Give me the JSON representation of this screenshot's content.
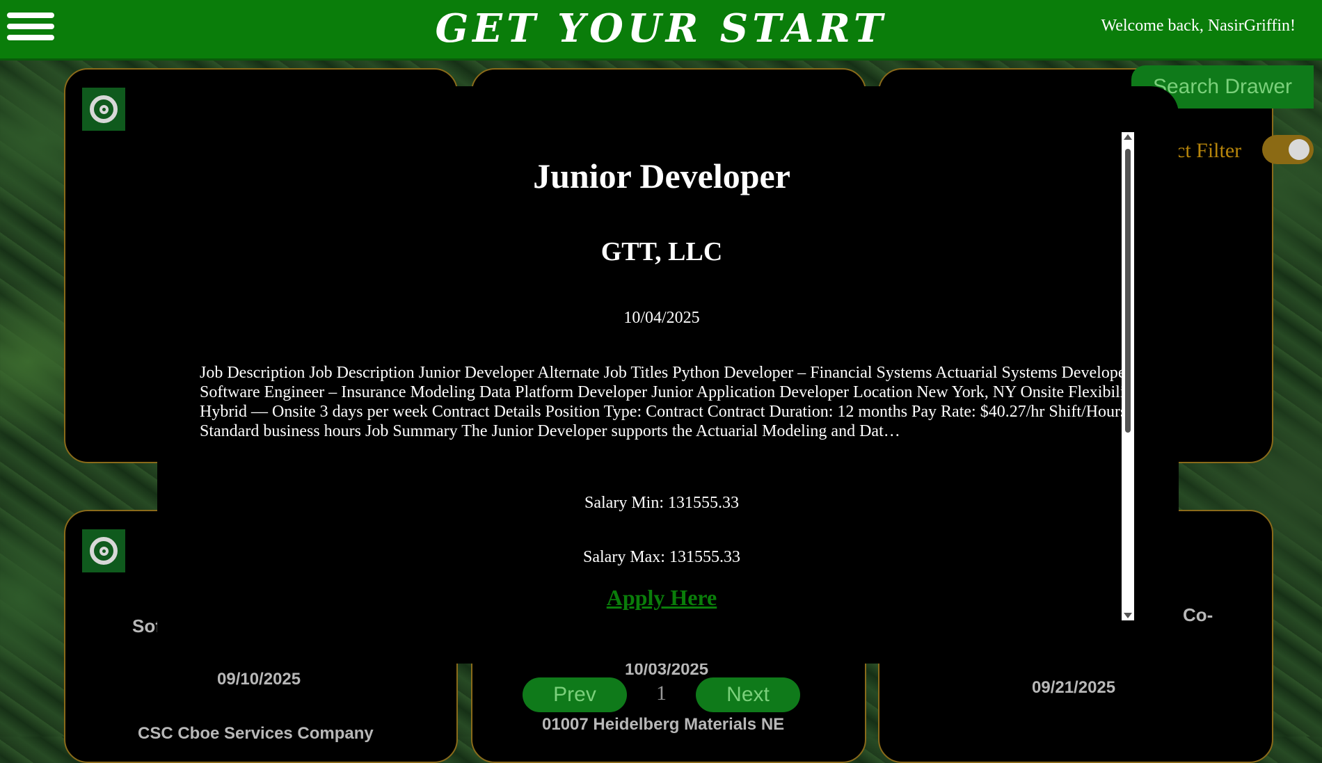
{
  "header": {
    "brand": "GET YOUR START",
    "welcome": "Welcome back, NasirGriffin!"
  },
  "drawer": {
    "search_label": "Search Drawer",
    "filter_label": "ct Filter",
    "filter_on": true
  },
  "cards": {
    "bottom_left": {
      "title_fragment": "Sof",
      "date": "09/10/2025",
      "company": "CSC Cboe Services Company"
    },
    "bottom_middle": {
      "date": "10/03/2025",
      "company": "01007 Heidelberg Materials NE"
    },
    "bottom_right": {
      "title_fragment": "Co-",
      "date": "09/21/2025"
    }
  },
  "modal": {
    "title": "Junior Developer",
    "company": "GTT, LLC",
    "date": "10/04/2025",
    "description": "Job Description Job Description Junior Developer Alternate Job Titles Python Developer – Financial Systems Actuarial Systems Developer Software Engineer – Insurance Modeling Data Platform Developer Junior Application Developer Location New York, NY Onsite Flexibility Hybrid — Onsite 3 days per week Contract Details Position Type: Contract Contract Duration: 12 months Pay Rate: $40.27/hr Shift/Hours: Standard business hours Job Summary The Junior Developer supports the Actuarial Modeling and Dat…",
    "salary_min": "Salary Min: 131555.33",
    "salary_max": "Salary Max: 131555.33",
    "apply_label": "Apply Here"
  },
  "pagination": {
    "prev_label": "Prev",
    "page": "1",
    "next_label": "Next"
  },
  "colors": {
    "header_bg": "#0a7d0a",
    "card_border": "#8a6a1a",
    "button_bg": "#0f7a1a",
    "button_text": "#7bd07b",
    "filter_gold": "#b8860b"
  }
}
